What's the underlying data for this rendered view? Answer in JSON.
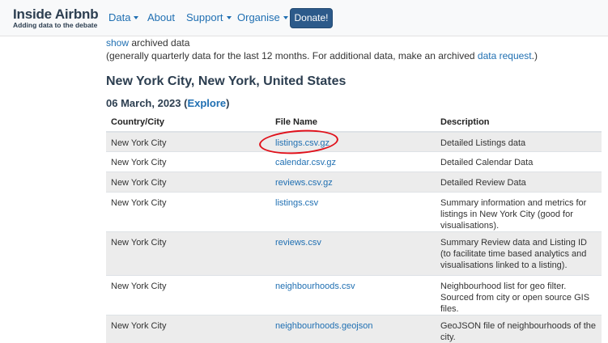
{
  "navbar": {
    "brand_title": "Inside Airbnb",
    "brand_subtitle": "Adding data to the debate",
    "items": [
      {
        "label": "Data",
        "dropdown": true
      },
      {
        "label": "About",
        "dropdown": false
      },
      {
        "label": "Support",
        "dropdown": true
      },
      {
        "label": "Organise",
        "dropdown": true
      }
    ],
    "donate_label": "Donate!"
  },
  "intro": {
    "show_link": "show",
    "show_suffix": " archived data",
    "note_prefix": "(generally quarterly data for the last 12 months. For additional data, make an archived ",
    "note_link": "data request",
    "note_suffix": ".)"
  },
  "city": {
    "title": "New York City, New York, United States",
    "date": "06 March, 2023",
    "open_paren": " (",
    "explore_link": "Explore",
    "close_paren": ")"
  },
  "table": {
    "headers": [
      "Country/City",
      "File Name",
      "Description"
    ],
    "rows": [
      {
        "city": "New York City",
        "file": "listings.csv.gz",
        "description": "Detailed Listings data"
      },
      {
        "city": "New York City",
        "file": "calendar.csv.gz",
        "description": "Detailed Calendar Data"
      },
      {
        "city": "New York City",
        "file": "reviews.csv.gz",
        "description": "Detailed Review Data"
      },
      {
        "city": "New York City",
        "file": "listings.csv",
        "description": "Summary information and metrics for listings in New York City (good for visualisations)."
      },
      {
        "city": "New York City",
        "file": "reviews.csv",
        "description": "Summary Review data and Listing ID (to facilitate time based analytics and visualisations linked to a listing)."
      },
      {
        "city": "New York City",
        "file": "neighbourhoods.csv",
        "description": "Neighbourhood list for geo filter. Sourced from city or open source GIS files."
      },
      {
        "city": "New York City",
        "file": "neighbourhoods.geojson",
        "description": "GeoJSON file of neighbourhoods of the city."
      }
    ]
  },
  "colors": {
    "link": "#1f6fb2",
    "heading": "#2c3e50",
    "annotation": "#e0101a",
    "donate_bg": "#2c5a8a"
  }
}
